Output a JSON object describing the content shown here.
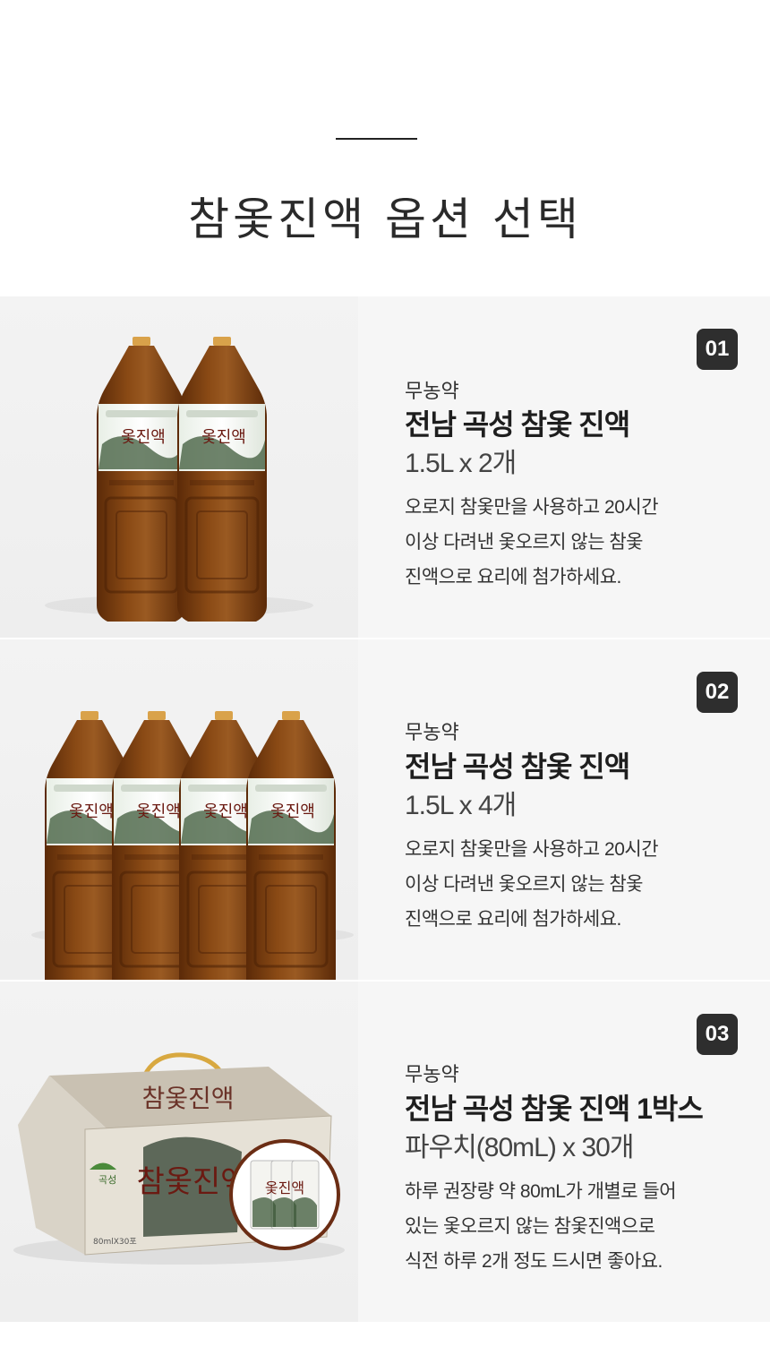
{
  "header": {
    "title": "참옻진액 옵션 선택"
  },
  "options": [
    {
      "badge": "01",
      "tag": "무농약",
      "name": "전남 곡성  참옻 진액",
      "qty": "1.5L x 2개",
      "desc": [
        "오로지 참옻만을 사용하고 20시간",
        "이상 다려낸 옻오르지 않는 참옻",
        "진액으로 요리에 첨가하세요."
      ],
      "bottle_count": 2
    },
    {
      "badge": "02",
      "tag": "무농약",
      "name": "전남 곡성 참옻 진액",
      "qty": "1.5L x 4개",
      "desc": [
        "오로지 참옻만을 사용하고 20시간",
        "이상 다려낸 옻오르지 않는 참옻",
        "진액으로 요리에 첨가하세요."
      ],
      "bottle_count": 4
    },
    {
      "badge": "03",
      "tag": "무농약",
      "name": "전남 곡성 참옻 진액 1박스",
      "qty": "파우치(80mL) x 30개",
      "desc": [
        "하루 권장량 약 80mL가 개별로 들어",
        "있는  옻오르지 않는 참옻진액으로",
        "식전 하루 2개 정도 드시면 좋아요."
      ],
      "box_label": "참옻진액",
      "box_small": "80mlX30포"
    }
  ],
  "colors": {
    "badge": "#2e2e2e",
    "liquid": "#7a3d10",
    "cap": "#d9a24a"
  }
}
